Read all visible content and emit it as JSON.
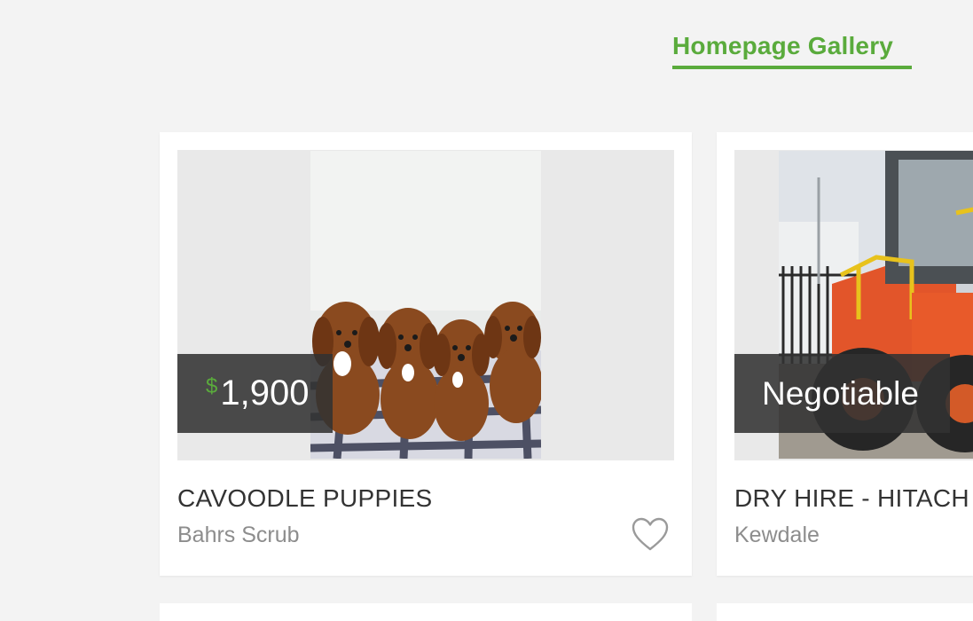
{
  "header": {
    "gallery_link": "Homepage Gallery"
  },
  "colors": {
    "accent": "#5aab3c",
    "background": "#f3f3f3",
    "price_tag_bg": "#323232"
  },
  "listings": [
    {
      "price_currency": "$",
      "price_amount": "1,900",
      "title": "CAVOODLE PUPPIES",
      "location": "Bahrs Scrub",
      "image": "photo of four ruby cavoodle puppies on a checked blanket",
      "favorite_icon": "heart-outline-icon"
    },
    {
      "price_text": "Negotiable",
      "title": "DRY HIRE - HITACH",
      "location": "Kewdale",
      "image": "photo of an orange wheel loader in a yard",
      "favorite_icon": "heart-outline-icon"
    }
  ]
}
